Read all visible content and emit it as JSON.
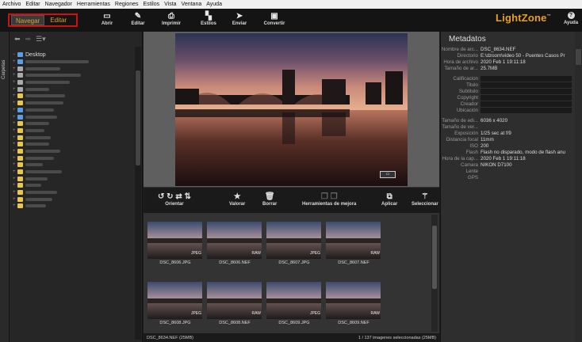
{
  "menu": [
    "Archivo",
    "Editar",
    "Navegador",
    "Herramientas",
    "Regiones",
    "Estilos",
    "Vista",
    "Ventana",
    "Ayuda"
  ],
  "modes": {
    "browse": "Navegar",
    "edit": "Editar"
  },
  "toolbar": [
    {
      "label": "Abrir",
      "icon": "open-icon"
    },
    {
      "label": "Editar",
      "icon": "edit-icon"
    },
    {
      "label": "Imprimir",
      "icon": "print-icon"
    },
    {
      "label": "Estilos",
      "icon": "styles-icon"
    },
    {
      "label": "Enviar",
      "icon": "send-icon"
    },
    {
      "label": "Convertir",
      "icon": "convert-icon"
    }
  ],
  "brand": {
    "name": "LightZone",
    "tm": "™"
  },
  "help": {
    "label": "Ayuda"
  },
  "left_tab": "Carpetas",
  "tree": {
    "root": "Desktop"
  },
  "actions": [
    {
      "label": "Orientar",
      "icons": [
        "rotate-left-icon",
        "rotate-right-icon",
        "flip-h-icon",
        "flip-v-icon"
      ]
    },
    {
      "label": "Valorar",
      "icons": [
        "star-icon"
      ]
    },
    {
      "label": "Borrar",
      "icons": [
        "trash-icon"
      ]
    },
    {
      "label": "Herramientas de mejora",
      "icons": [
        "copy-tools-icon",
        "paste-tools-icon"
      ]
    },
    {
      "label": "Aplicar",
      "icons": [
        "apply-icon"
      ]
    },
    {
      "label": "Seleccionar",
      "icons": [
        "magic-wand-icon"
      ]
    }
  ],
  "thumbnails": [
    {
      "name": "DSC_8606.JPG",
      "tag": "JPEG"
    },
    {
      "name": "DSC_8606.NEF",
      "tag": "RAW"
    },
    {
      "name": "DSC_8607.JPG",
      "tag": "JPEG"
    },
    {
      "name": "DSC_8607.NEF",
      "tag": "RAW"
    },
    {
      "name": "DSC_8608.JPG",
      "tag": "JPEG"
    },
    {
      "name": "DSC_8608.NEF",
      "tag": "RAW"
    },
    {
      "name": "DSC_8609.JPG",
      "tag": "JPEG"
    },
    {
      "name": "DSC_8609.NEF",
      "tag": "RAW"
    }
  ],
  "status": {
    "file": "DSC_8634.NEF (25MB)",
    "selection": "1 / 137 imagenes seleccionadas (25MB)"
  },
  "metadata": {
    "title": "Metadatos",
    "file_rows": [
      {
        "k": "Nombre de arc...",
        "v": "DSC_8634.NEF"
      },
      {
        "k": "Directorio",
        "v": "E:\\dzoom\\video 50 - Puentes Casos Pr"
      },
      {
        "k": "Hora de archivo",
        "v": "2020 Feb 1 19:11:18"
      },
      {
        "k": "Tamaño de ar...",
        "v": "25.7MB"
      }
    ],
    "iptc_rows": [
      "Calificacion",
      "Titulo",
      "Subtitulo",
      "Copyright",
      "Creador",
      "Ubicación"
    ],
    "exif_rows": [
      {
        "k": "Tamaño de edi...",
        "v": "6036 x 4020"
      },
      {
        "k": "Tamaño de ver...",
        "v": ""
      },
      {
        "k": "Exposición",
        "v": "1/25 sec at f/9"
      },
      {
        "k": "Distancia focal",
        "v": "11mm"
      },
      {
        "k": "ISO",
        "v": "200"
      },
      {
        "k": "Flash",
        "v": "Flash no disparado, modo de flash anu"
      },
      {
        "k": "Hora de la cap...",
        "v": "2020 Feb 1 19:11:18"
      },
      {
        "k": "Camara",
        "v": "NIKON D7100"
      },
      {
        "k": "Lente",
        "v": ""
      },
      {
        "k": "GPS",
        "v": ""
      }
    ]
  },
  "colors": {
    "accent": "#e0a030",
    "highlight": "#d01010"
  }
}
